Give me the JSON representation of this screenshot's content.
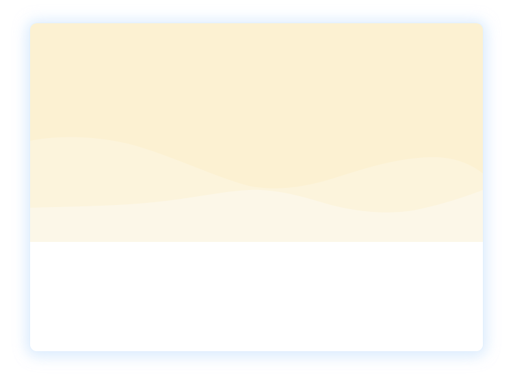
{
  "card": {
    "hero": {
      "background_color": "#fcf1d2",
      "wave_back_color": "#fcf4dc",
      "wave_front_color": "#fcf7e8"
    },
    "body": {
      "background_color": "#ffffff"
    }
  }
}
